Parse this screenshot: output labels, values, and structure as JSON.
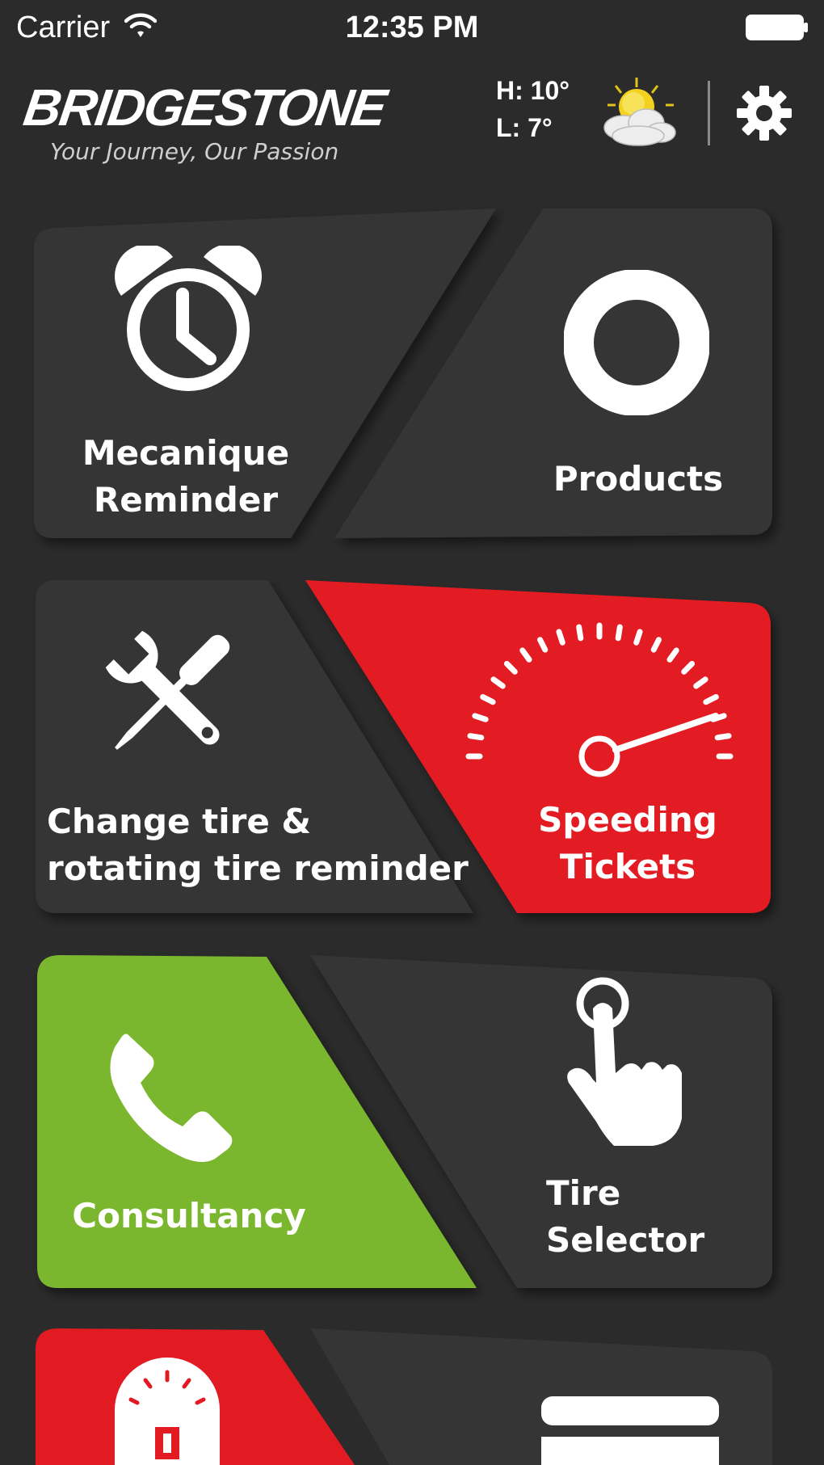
{
  "status_bar": {
    "carrier": "Carrier",
    "time": "12:35 PM",
    "icons": [
      "wifi-icon",
      "battery-icon"
    ]
  },
  "header": {
    "logo_text": "BRIDGESTONE",
    "tagline": "Your Journey, Our Passion",
    "weather": {
      "high": "H: 10°",
      "low": "L: 7°",
      "icon": "partly-cloudy-icon"
    },
    "settings_icon": "gear-icon"
  },
  "colors": {
    "background": "#2b2b2b",
    "tile_dark": "#353535",
    "tile_red": "#e21b23",
    "tile_green": "#7ab72f",
    "text": "#ffffff"
  },
  "tiles": [
    {
      "label_line1": "Mecanique",
      "label_line2": "Reminder",
      "icon": "alarm-clock-icon",
      "color": "dark"
    },
    {
      "label": "Products",
      "icon": "tire-icon",
      "color": "dark"
    },
    {
      "label_line1": "Change tire &",
      "label_line2": "rotating tire reminder",
      "icon": "wrench-screwdriver-icon",
      "color": "dark"
    },
    {
      "label_line1": "Speeding",
      "label_line2": "Tickets",
      "icon": "speedometer-icon",
      "color": "red"
    },
    {
      "label": "Consultancy",
      "icon": "phone-icon",
      "color": "green"
    },
    {
      "label_line1": "Tire",
      "label_line2": "Selector",
      "icon": "tap-hand-icon",
      "color": "dark"
    },
    {
      "label": "",
      "icon": "parking-meter-icon",
      "color": "red"
    },
    {
      "label": "",
      "icon": "menu-icon",
      "color": "dark"
    }
  ]
}
